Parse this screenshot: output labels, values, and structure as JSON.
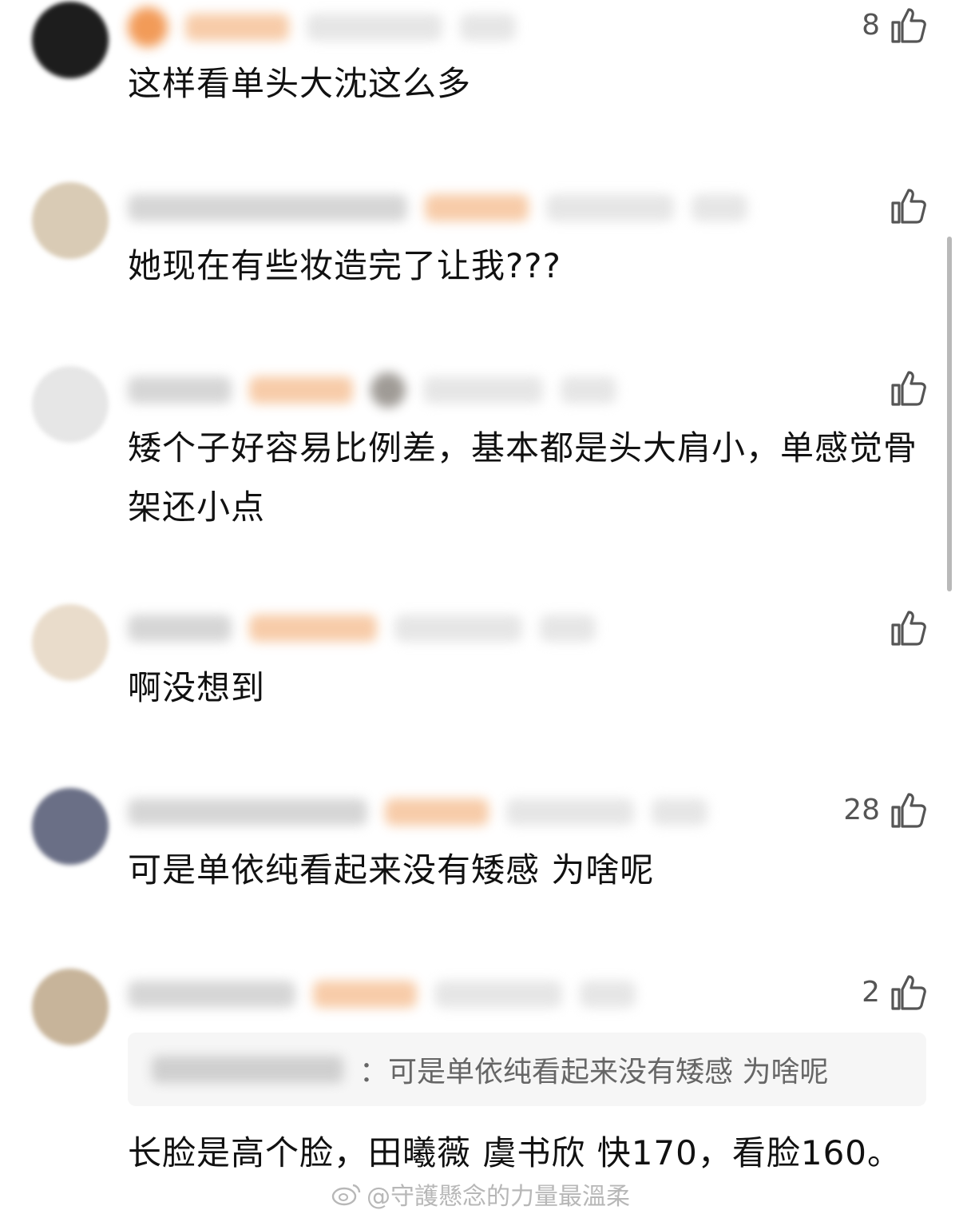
{
  "comments": [
    {
      "likes": "8",
      "text": "这样看单头大沈这么多"
    },
    {
      "likes": "",
      "text": "她现在有些妆造完了让我???"
    },
    {
      "likes": "",
      "text": "矮个子好容易比例差，基本都是头大肩小，单感觉骨架还小点"
    },
    {
      "likes": "",
      "text": "啊没想到"
    },
    {
      "likes": "28",
      "text": "可是单依纯看起来没有矮感 为啥呢"
    },
    {
      "likes": "2",
      "quote": "：可是单依纯看起来没有矮感 为啥呢",
      "text": "长脸是高个脸，田曦薇 虞书欣 快170，看脸160。"
    }
  ],
  "watermark": "@守護懸念的力量最溫柔",
  "colors": {
    "like_icon": "#555555",
    "badge_blur": "#f6c39a",
    "quote_bg": "#f6f6f6"
  }
}
